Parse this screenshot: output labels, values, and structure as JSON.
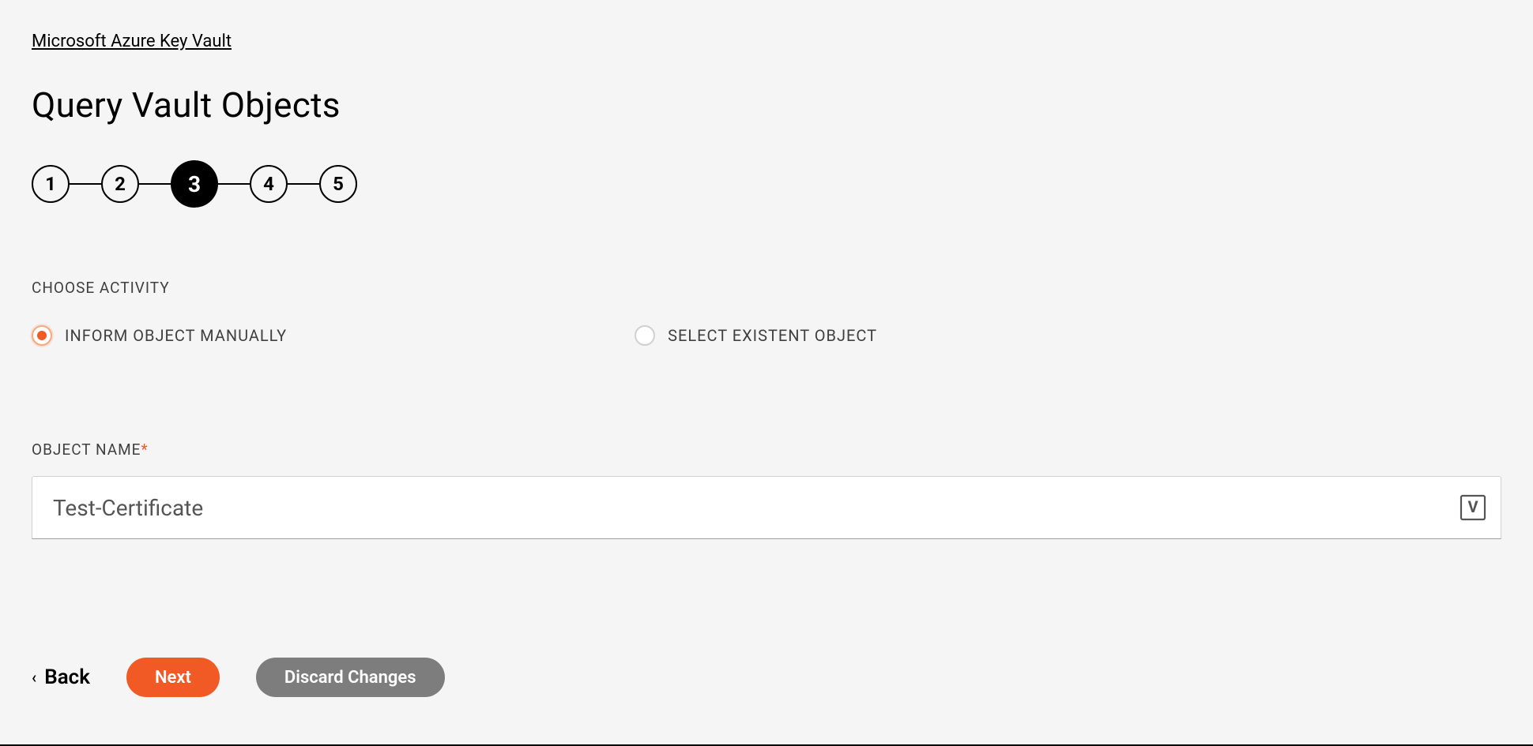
{
  "breadcrumb": "Microsoft Azure Key Vault",
  "title": "Query Vault Objects",
  "stepper": {
    "steps": [
      "1",
      "2",
      "3",
      "4",
      "5"
    ],
    "active_index": 2
  },
  "activity": {
    "label": "CHOOSE ACTIVITY",
    "options": {
      "manual": "INFORM OBJECT MANUALLY",
      "existent": "SELECT EXISTENT OBJECT"
    },
    "selected": "manual"
  },
  "object_name": {
    "label": "OBJECT NAME",
    "required_marker": "*",
    "value": "Test-Certificate",
    "input_icon_name": "variable-icon"
  },
  "footer": {
    "back": "Back",
    "next": "Next",
    "discard": "Discard Changes"
  }
}
